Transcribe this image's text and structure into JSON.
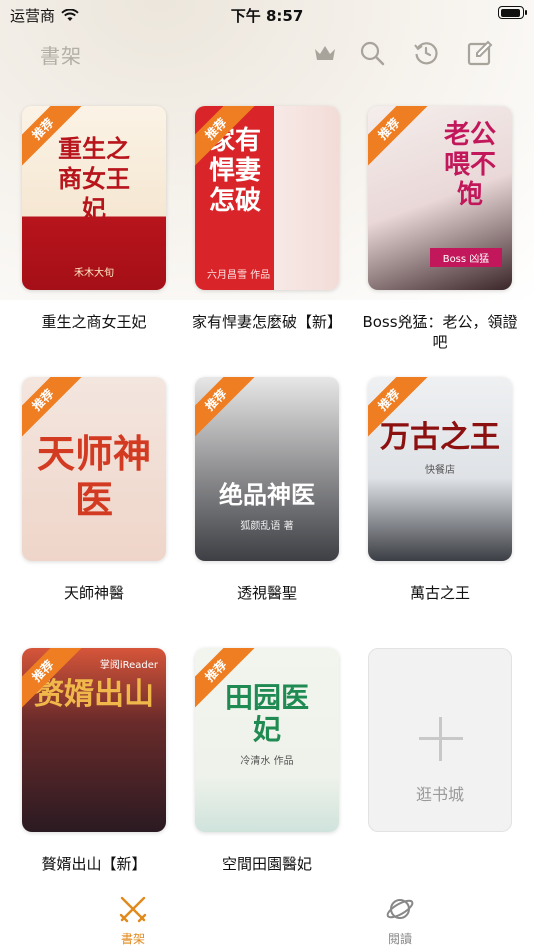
{
  "status_bar": {
    "carrier": "运营商",
    "time": "下午 8:57"
  },
  "nav": {
    "title": "書架",
    "icons": [
      "crown-icon",
      "search-icon",
      "history-icon",
      "edit-icon"
    ]
  },
  "badge_label": "推荐",
  "books": [
    {
      "title": "重生之商女王妃",
      "cover_title": "重生之商女王妃",
      "cover_sub": "禾木大旬",
      "cover_colors": [
        "#fbf3e6",
        "#b8141c"
      ],
      "recommended": true
    },
    {
      "title": "家有悍妻怎麼破【新】",
      "cover_title": "家有悍妻怎破",
      "cover_sub": "六月昌雪 作品",
      "cover_colors": [
        "#d9252a",
        "#f7e9e6"
      ],
      "recommended": true
    },
    {
      "title": "Boss兇猛：老公，領證吧",
      "cover_title": "老公喂不饱",
      "cover_sub": "Boss 凶猛",
      "cover_colors": [
        "#f4eeec",
        "#c2185b"
      ],
      "recommended": true
    },
    {
      "title": "天師神醫",
      "cover_title": "天师神医",
      "cover_sub": "",
      "cover_colors": [
        "#f3e6df",
        "#d33a22"
      ],
      "recommended": true
    },
    {
      "title": "透視醫聖",
      "cover_title": "绝品神医",
      "cover_sub": "狐颜乱语 著",
      "cover_colors": [
        "#3d3f44",
        "#e7e7e7"
      ],
      "recommended": true
    },
    {
      "title": "萬古之王",
      "cover_title": "万古之王",
      "cover_sub": "快餐店",
      "cover_colors": [
        "#eef0f2",
        "#8c1010"
      ],
      "recommended": true
    },
    {
      "title": "贅婿出山【新】",
      "cover_title": "赘婿出山",
      "cover_sub": "掌阅iReader",
      "cover_colors": [
        "#2b1a22",
        "#f0b84a"
      ],
      "recommended": true
    },
    {
      "title": "空間田園醫妃",
      "cover_title": "田园医妃",
      "cover_sub": "冷清水 作品",
      "cover_colors": [
        "#f2f5ee",
        "#1f8a52"
      ],
      "recommended": true
    }
  ],
  "add_card": {
    "label": "逛书城"
  },
  "tabs": [
    {
      "label": "書架",
      "icon": "bookshelf-icon",
      "active": true
    },
    {
      "label": "閱讀",
      "icon": "planet-icon",
      "active": false
    }
  ],
  "colors": {
    "accent": "#e08a1e",
    "badge": "#ef7d22",
    "inactive": "#888888"
  }
}
